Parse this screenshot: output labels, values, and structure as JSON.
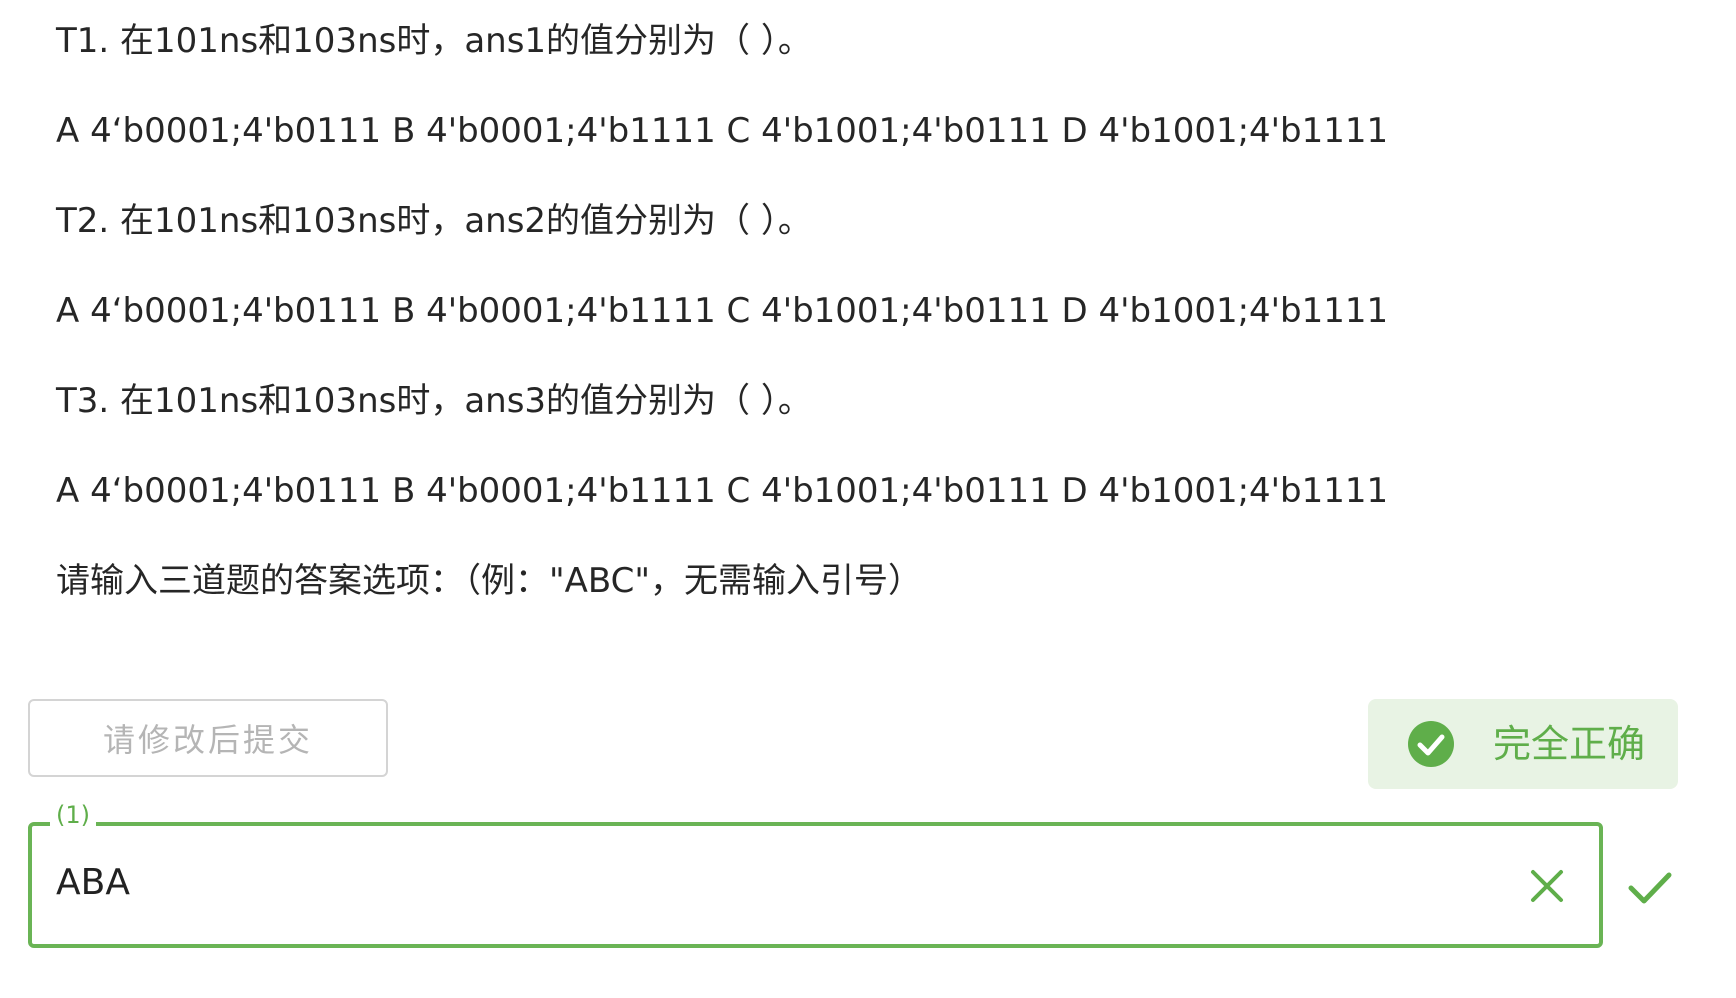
{
  "questions": [
    {
      "prompt": "T1. 在101ns和103ns时，ans1的值分别为（ ）。",
      "options": "A 4‘b0001;4'b0111 B 4'b0001;4'b1111 C 4'b1001;4'b0111 D 4'b1001;4'b1111"
    },
    {
      "prompt": "T2. 在101ns和103ns时，ans2的值分别为（ ）。",
      "options": "A 4‘b0001;4'b0111 B 4'b0001;4'b1111 C 4'b1001;4'b0111 D 4'b1001;4'b1111"
    },
    {
      "prompt": "T3. 在101ns和103ns时，ans3的值分别为（ ）。",
      "options": "A 4‘b0001;4'b0111 B 4'b0001;4'b1111 C 4'b1001;4'b0111 D 4'b1001;4'b1111"
    }
  ],
  "instruction": "请输入三道题的答案选项：（例：\"ABC\"，无需输入引号）",
  "submit_button": {
    "label": "请修改后提交"
  },
  "result": {
    "label": "完全正确",
    "icon": "check-circle-icon",
    "color": "#5fae4a"
  },
  "answer_field": {
    "label": "(1)",
    "value": "ABA",
    "clear_icon": "close-icon",
    "status_icon": "check-icon"
  }
}
